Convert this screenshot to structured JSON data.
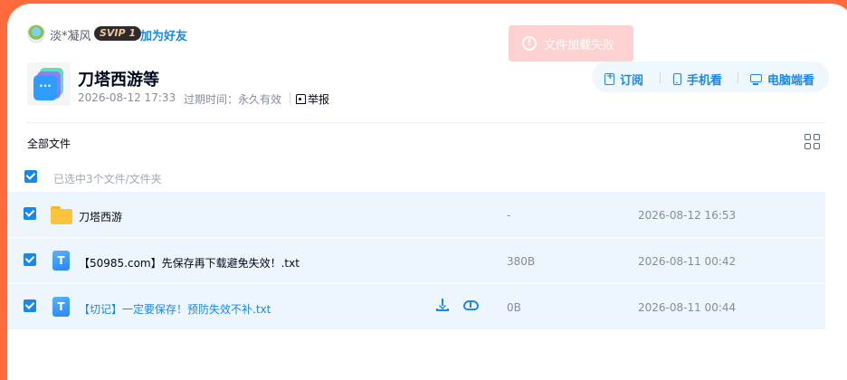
{
  "sharer": {
    "name": "淡*凝风",
    "vip_badge": "SVIP 1",
    "add_friend": "加为好友"
  },
  "toast": {
    "text": "文件加载失败",
    "icon": "alert-circle-icon"
  },
  "share": {
    "title": "刀塔西游等",
    "date": "2026-08-12 17:33",
    "expire_label": "过期时间：",
    "expire_value": "永久有效",
    "report": "举报"
  },
  "actions": {
    "subscribe": "订阅",
    "phone": "手机看",
    "pc": "电脑端看"
  },
  "toolbar": {
    "all_files": "全部文件",
    "selected_info": "已选中3个文件/文件夹"
  },
  "files": [
    {
      "name": "刀塔西游",
      "type": "folder",
      "size": "-",
      "date": "2026-08-12 16:53",
      "checked": true
    },
    {
      "name": "【50985.com】先保存再下载避免失效！.txt",
      "type": "txt",
      "size": "380B",
      "date": "2026-08-11 00:42",
      "checked": true
    },
    {
      "name": "【切记】一定要保存！预防失效不补.txt",
      "type": "txt",
      "size": "0B",
      "date": "2026-08-11 00:44",
      "checked": true,
      "hovered": true
    }
  ],
  "file_type_icon_label": "T",
  "colors": {
    "accent": "#1b87e6",
    "page_bg": "#ff6a3d",
    "row_selected": "#eef6fd",
    "toast_bg": "#ffd2d2"
  }
}
